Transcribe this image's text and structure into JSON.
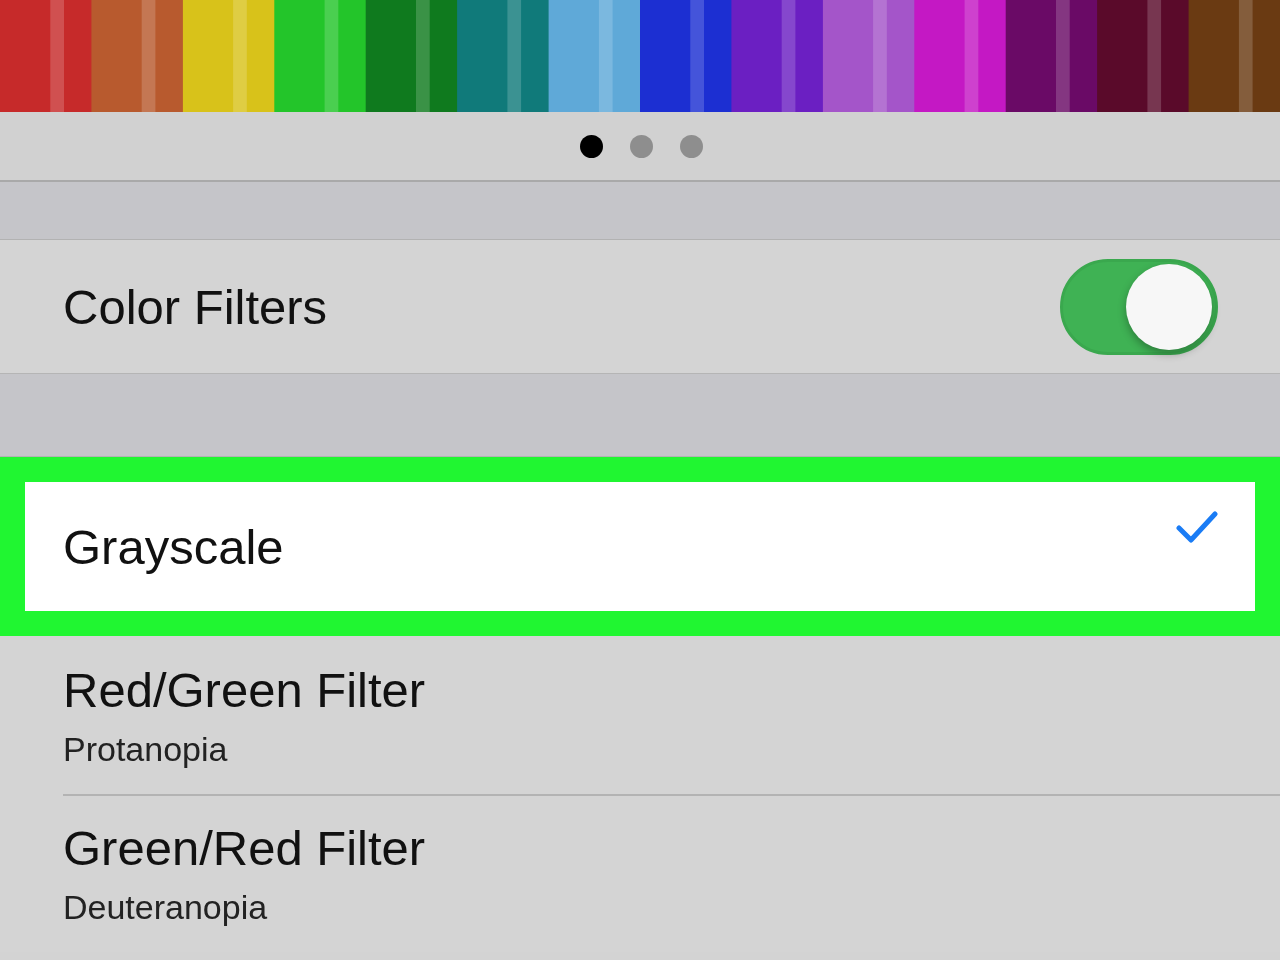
{
  "page_dots": [
    {
      "selected": true
    },
    {
      "selected": false
    },
    {
      "selected": false
    }
  ],
  "color_filters": {
    "label": "Color Filters",
    "on": true
  },
  "filters": [
    {
      "title": "Grayscale",
      "selected": true,
      "highlighted": true
    },
    {
      "title": "Red/Green Filter",
      "subtitle": "Protanopia",
      "selected": false,
      "highlighted": false
    },
    {
      "title": "Green/Red Filter",
      "subtitle": "Deuteranopia",
      "selected": false,
      "highlighted": false
    }
  ]
}
